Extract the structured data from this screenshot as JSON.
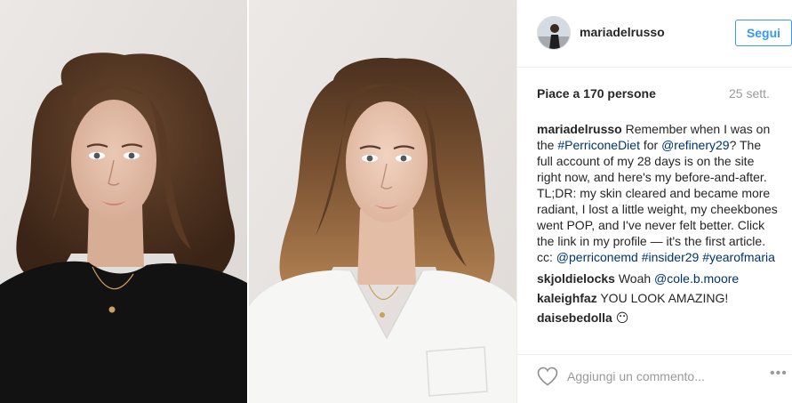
{
  "post": {
    "username": "mariadelrusso",
    "follow_label": "Segui",
    "likes_text": "Piace a 170 persone",
    "timestamp": "25 sett.",
    "caption": {
      "user": "mariadelrusso",
      "text_1": " Remember when I was on the ",
      "hashtag_1": "#PerriconeDiet",
      "text_2": " for ",
      "mention_1": "@refinery29",
      "text_3": "? The full account of my 28 days is on the site right now, and here's my before-and-after. TL;DR: my skin cleared and became more radiant, I lost a little weight, my cheekbones went POP, and I've never felt better. Click the link in my profile — it's the first article. cc: ",
      "mention_2": "@perriconemd",
      "hashtag_2": "#insider29",
      "hashtag_3": "#yearofmaria"
    },
    "comments": [
      {
        "user": "skjoldielocks",
        "text": " Woah ",
        "mention": "@cole.b.moore"
      },
      {
        "user": "kaleighfaz",
        "text": " YOU LOOK AMAZING!"
      },
      {
        "user": "daisebedolla",
        "text": " 😶"
      }
    ],
    "comment_placeholder": "Aggiungi un commento...",
    "more_label": "•••"
  },
  "icons": {
    "like": "heart-outline-icon",
    "more": "more-options-icon"
  },
  "colors": {
    "link": "#003569",
    "follow": "#3897f0",
    "muted": "#999999"
  }
}
